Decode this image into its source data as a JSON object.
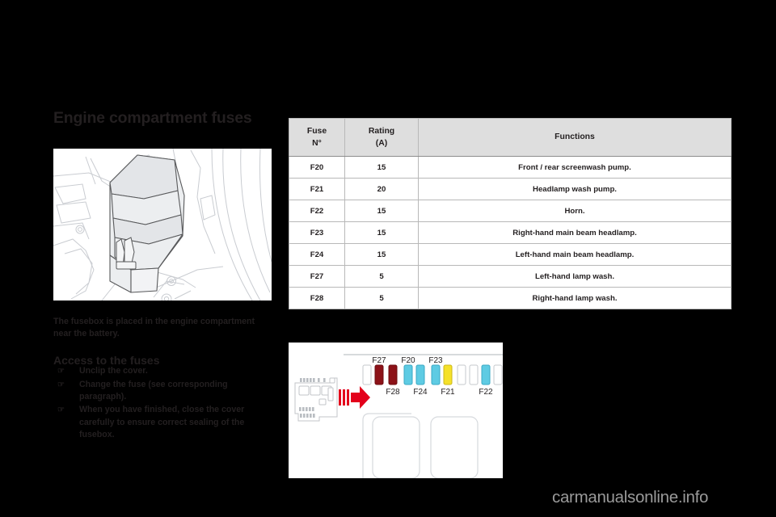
{
  "page": {
    "title": "Engine compartment fuses",
    "intro": "The fusebox is placed in the engine compartment near the battery.",
    "subhead": "Access to the fuses",
    "bullet_marker": "☞",
    "bullets": [
      "Unclip the cover.",
      "Change the fuse (see corresponding paragraph).",
      "When you have finished, close the cover carefully to ensure correct sealing of the fusebox."
    ],
    "watermark": "carmanualsonline.info"
  },
  "table": {
    "headers": {
      "fuse_line1": "Fuse",
      "fuse_line2": "N°",
      "rating_line1": "Rating",
      "rating_line2": "(A)",
      "functions": "Functions"
    },
    "rows": [
      {
        "fuse": "F20",
        "rating": "15",
        "function": "Front / rear screenwash pump."
      },
      {
        "fuse": "F21",
        "rating": "20",
        "function": "Headlamp wash pump."
      },
      {
        "fuse": "F22",
        "rating": "15",
        "function": "Horn."
      },
      {
        "fuse": "F23",
        "rating": "15",
        "function": "Right-hand main beam headlamp."
      },
      {
        "fuse": "F24",
        "rating": "15",
        "function": "Left-hand main beam headlamp."
      },
      {
        "fuse": "F27",
        "rating": "5",
        "function": "Left-hand lamp wash."
      },
      {
        "fuse": "F28",
        "rating": "5",
        "function": "Right-hand lamp wash."
      }
    ]
  },
  "diagram": {
    "labels_top": [
      "F27",
      "F20",
      "F23"
    ],
    "labels_bottom": [
      "F28",
      "F24",
      "F21",
      "F22"
    ],
    "fuse_colors": {
      "dark_red": "#8c1218",
      "cyan": "#5ecbe3",
      "yellow": "#f5e12a",
      "empty": "#ffffff",
      "arrow": "#e3001b"
    },
    "slots": [
      {
        "color": "empty"
      },
      {
        "color": "dark_red",
        "label": "F27"
      },
      {
        "color": "dark_red",
        "label": "F28"
      },
      {
        "color": "cyan",
        "label": "F20"
      },
      {
        "color": "cyan",
        "label": "F24"
      },
      {
        "color": "cyan",
        "label": "F23"
      },
      {
        "color": "yellow",
        "label": "F21"
      },
      {
        "color": "empty"
      },
      {
        "color": "empty"
      },
      {
        "color": "cyan",
        "label": "F22"
      },
      {
        "color": "empty"
      }
    ]
  },
  "colors": {
    "page_background": "#000000",
    "text": "#231f20",
    "table_header_fill": "#dedede",
    "table_border": "#b8b8b8",
    "watermark": "#9a9a9a"
  }
}
